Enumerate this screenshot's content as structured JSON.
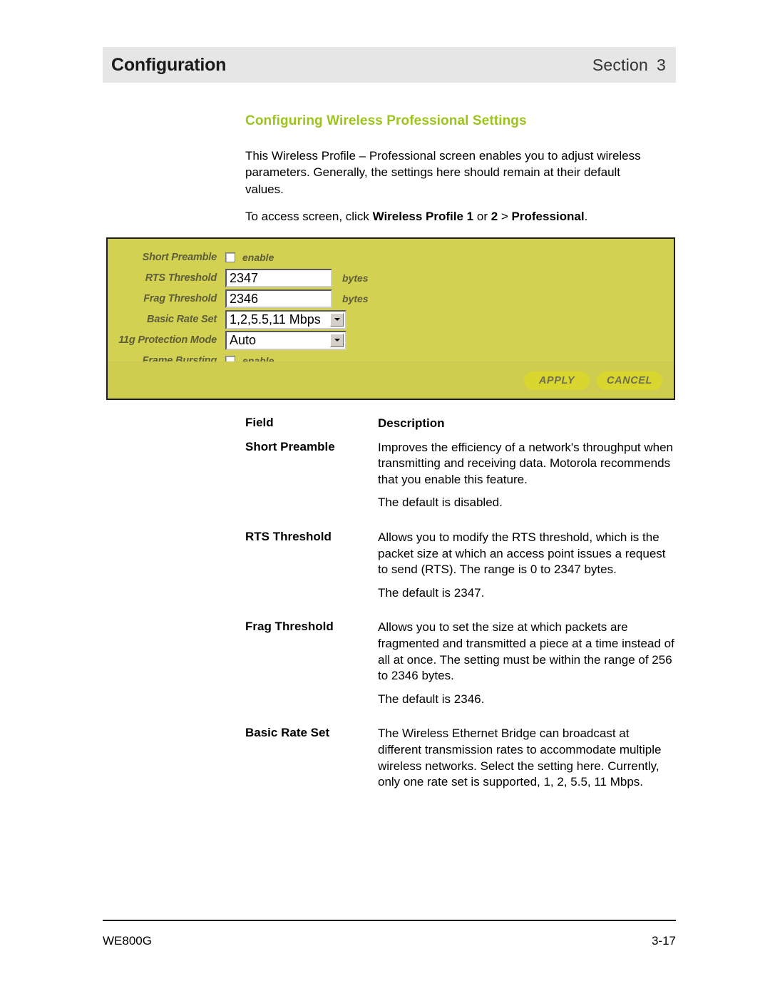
{
  "header": {
    "title": "Configuration",
    "section_label": "Section",
    "section_number": "3"
  },
  "content": {
    "section_heading": "Configuring Wireless Professional Settings",
    "paragraph_1": "This Wireless Profile – Professional screen enables you to adjust wireless parameters. Generally, the settings here should remain at their default values.",
    "access_prefix": "To access screen, click ",
    "access_bold_1": "Wireless Profile 1",
    "access_mid": " or ",
    "access_bold_2": "2",
    "access_gt": " > ",
    "access_bold_3": "Professional",
    "access_suffix": "."
  },
  "screenshot": {
    "rows": [
      {
        "label": "Short Preamble",
        "type": "checkbox",
        "checked": false,
        "checkbox_label": "enable"
      },
      {
        "label": "RTS Threshold",
        "type": "text",
        "value": "2347",
        "unit": "bytes"
      },
      {
        "label": "Frag Threshold",
        "type": "text",
        "value": "2346",
        "unit": "bytes"
      },
      {
        "label": "Basic Rate Set",
        "type": "select",
        "value": "1,2,5.5,11 Mbps"
      },
      {
        "label": "11g Protection Mode",
        "type": "select",
        "value": "Auto"
      },
      {
        "label": "Frame Bursting",
        "type": "checkbox",
        "checked": false,
        "checkbox_label": "enable"
      }
    ],
    "buttons": {
      "apply": "APPLY",
      "cancel": "CANCEL"
    },
    "colors": {
      "panel_background": "#d3d152",
      "panel_footer_background": "#cfcd4f",
      "button_background": "#d8d62f",
      "label_text": "#5d5e3b",
      "border": "#1d1d1d"
    }
  },
  "field_table": {
    "header": {
      "field": "Field",
      "description": "Description"
    },
    "rows": [
      {
        "field": "Short Preamble",
        "paragraphs": [
          "Improves the efficiency of a network's throughput when transmitting and receiving data. Motorola recommends that you enable this feature.",
          "The default is disabled."
        ]
      },
      {
        "field": "RTS Threshold",
        "paragraphs": [
          "Allows you to modify the RTS threshold, which is the packet size at which an access point issues a request to send (RTS). The range is 0 to 2347 bytes.",
          "The default is 2347."
        ]
      },
      {
        "field": "Frag Threshold",
        "paragraphs": [
          "Allows you to set the size at which packets are fragmented and transmitted a piece at a time instead of all at once. The setting must be within the range of 256 to 2346 bytes.",
          "The default is 2346."
        ]
      },
      {
        "field": "Basic Rate Set",
        "paragraphs": [
          "The Wireless Ethernet Bridge can broadcast at different transmission rates to accommodate multiple wireless networks. Select the setting here. Currently, only one rate set is supported, 1, 2, 5.5, 11 Mbps."
        ]
      }
    ]
  },
  "footer": {
    "model": "WE800G",
    "page_number": "3-17"
  },
  "theme": {
    "heading_green": "#9dc41d",
    "header_band_gray": "#e6e6e6"
  }
}
